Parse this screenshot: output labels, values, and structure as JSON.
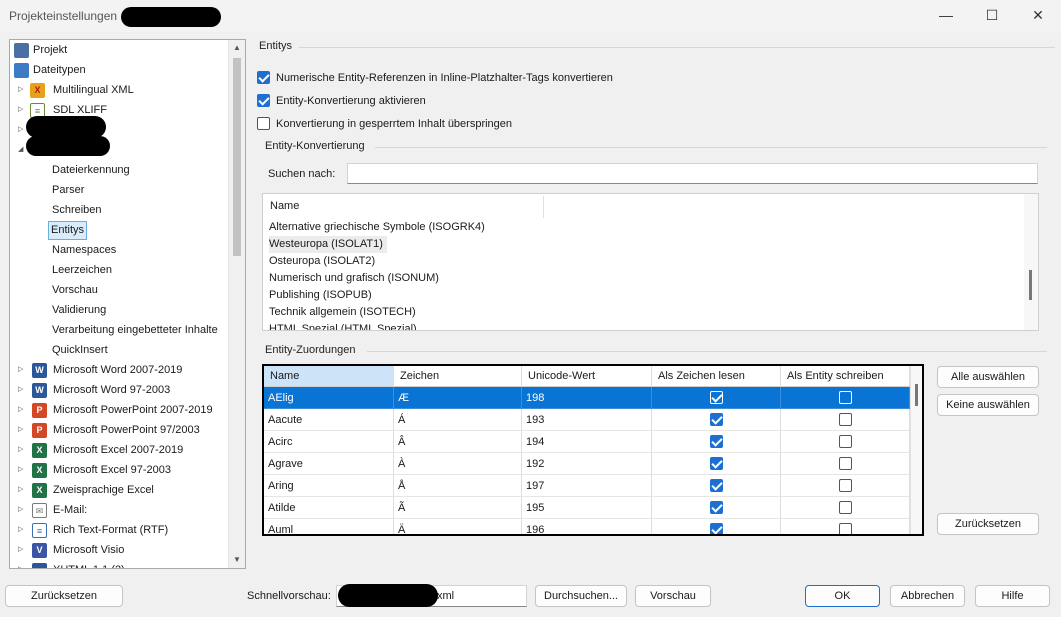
{
  "window": {
    "title": "Projekteinstellungen",
    "minimize_glyph": "—",
    "maximize_glyph": "☐",
    "close_glyph": "✕"
  },
  "tree": {
    "items": [
      {
        "label": "Projekt",
        "icon": "project-icon",
        "color": "#4a6fa5"
      },
      {
        "label": "Dateitypen",
        "icon": "filetypes-icon",
        "color": "#3d7bc4"
      },
      {
        "label": "Multilingual XML",
        "icon": "xml-shield-icon",
        "color": "#e6a21a"
      },
      {
        "label": "SDL XLIFF",
        "icon": "sdlxliff-icon",
        "color": "#6a8a3a"
      },
      {
        "label": "Dateierkennung"
      },
      {
        "label": "Parser"
      },
      {
        "label": "Schreiben"
      },
      {
        "label": "Entitys"
      },
      {
        "label": "Namespaces"
      },
      {
        "label": "Leerzeichen"
      },
      {
        "label": "Vorschau"
      },
      {
        "label": "Validierung"
      },
      {
        "label": "Verarbeitung eingebetteter Inhalte"
      },
      {
        "label": "QuickInsert"
      },
      {
        "label": "Microsoft Word 2007-2019",
        "icon": "word-icon",
        "color": "#2b579a"
      },
      {
        "label": "Microsoft Word 97-2003",
        "icon": "word-icon",
        "color": "#2b579a"
      },
      {
        "label": "Microsoft PowerPoint 2007-2019",
        "icon": "powerpoint-icon",
        "color": "#d24726"
      },
      {
        "label": "Microsoft PowerPoint 97/2003",
        "icon": "powerpoint-icon",
        "color": "#d24726"
      },
      {
        "label": "Microsoft Excel 2007-2019",
        "icon": "excel-icon",
        "color": "#217346"
      },
      {
        "label": "Microsoft Excel 97-2003",
        "icon": "excel-icon",
        "color": "#217346"
      },
      {
        "label": "Zweisprachige Excel",
        "icon": "excel-icon",
        "color": "#217346"
      },
      {
        "label": "E-Mail:",
        "icon": "email-icon",
        "color": "#7a7a7a"
      },
      {
        "label": "Rich Text-Format (RTF)",
        "icon": "rtf-icon",
        "color": "#3d6eb3"
      },
      {
        "label": "Microsoft Visio",
        "icon": "visio-icon",
        "color": "#3955a3"
      },
      {
        "label": "XHTML 1.1 (2)",
        "icon": "xhtml-icon",
        "color": "#2b579a"
      }
    ]
  },
  "entitys": {
    "section_title": "Entitys",
    "options": [
      {
        "label": "Numerische Entity-Referenzen in Inline-Platzhalter-Tags konvertieren",
        "checked": true
      },
      {
        "label": "Entity-Konvertierung aktivieren",
        "checked": true
      },
      {
        "label": "Konvertierung in gesperrtem Inhalt überspringen",
        "checked": false
      }
    ]
  },
  "konvertierung": {
    "section_title": "Entity-Konvertierung",
    "search_label": "Suchen nach:",
    "search_value": "",
    "column_header": "Name",
    "items": [
      "Alternative griechische Symbole (ISOGRK4)",
      "Westeuropa (ISOLAT1)",
      "Osteuropa (ISOLAT2)",
      "Numerisch und grafisch (ISONUM)",
      "Publishing (ISOPUB)",
      "Technik allgemein (ISOTECH)",
      "HTML Spezial (HTML Spezial)"
    ]
  },
  "zuordnungen": {
    "section_title": "Entity-Zuordungen",
    "columns": [
      "Name",
      "Zeichen",
      "Unicode-Wert",
      "Als Zeichen lesen",
      "Als Entity schreiben"
    ],
    "rows": [
      {
        "name": "AElig",
        "char": "Æ",
        "code": "198",
        "read": true,
        "write": false
      },
      {
        "name": "Aacute",
        "char": "Á",
        "code": "193",
        "read": true,
        "write": false
      },
      {
        "name": "Acirc",
        "char": "Â",
        "code": "194",
        "read": true,
        "write": false
      },
      {
        "name": "Agrave",
        "char": "À",
        "code": "192",
        "read": true,
        "write": false
      },
      {
        "name": "Aring",
        "char": "Å",
        "code": "197",
        "read": true,
        "write": false
      },
      {
        "name": "Atilde",
        "char": "Ã",
        "code": "195",
        "read": true,
        "write": false
      },
      {
        "name": "Auml",
        "char": "Ä",
        "code": "196",
        "read": true,
        "write": false
      }
    ],
    "btn_select_all": "Alle auswählen",
    "btn_select_none": "Keine auswählen",
    "btn_reset": "Zurücksetzen"
  },
  "footer": {
    "reset": "Zurücksetzen",
    "preview_label": "Schnellvorschau:",
    "preview_value": "xml",
    "browse": "Durchsuchen...",
    "preview": "Vorschau",
    "ok": "OK",
    "cancel": "Abbrechen",
    "help": "Hilfe"
  }
}
